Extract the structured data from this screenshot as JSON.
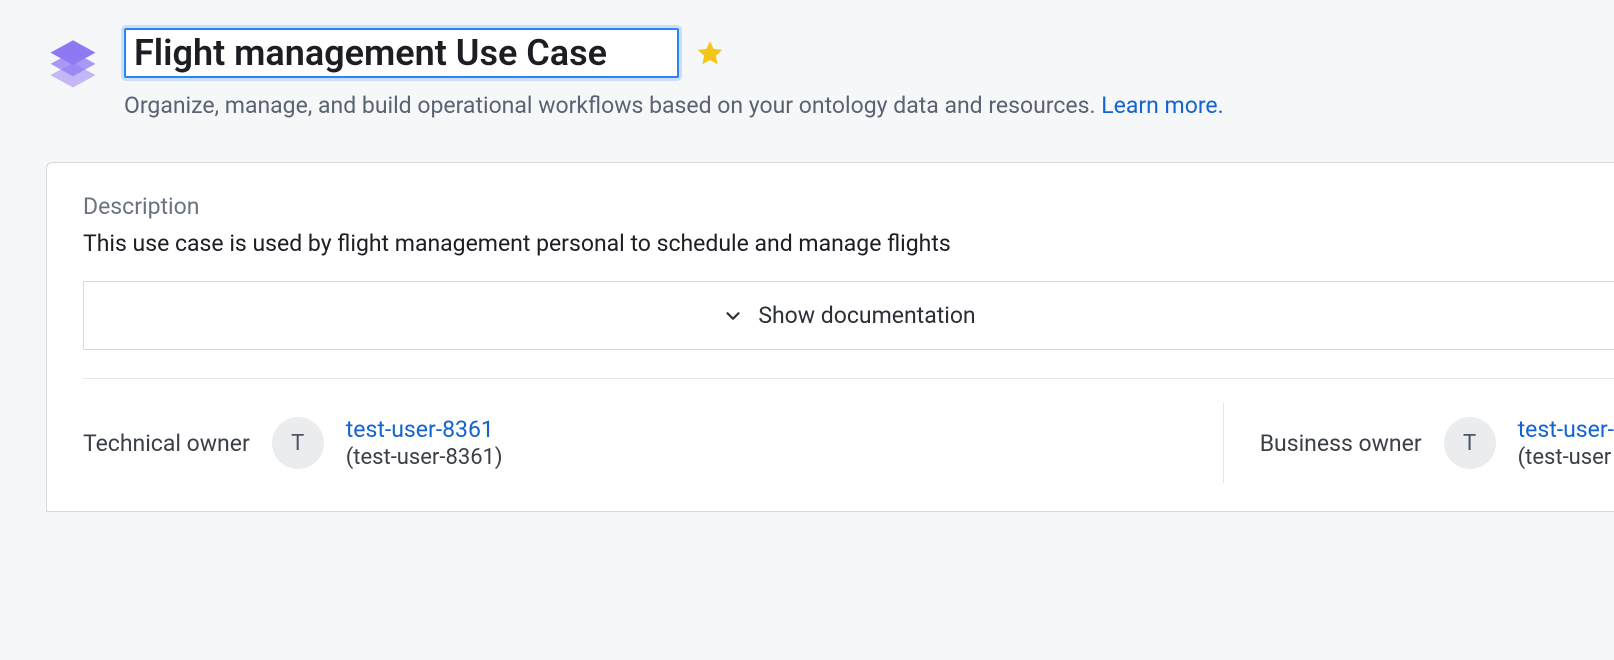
{
  "header": {
    "title": "Flight management Use Case",
    "subtitle": "Organize, manage, and build operational workflows based on your ontology data and resources.",
    "learn_more": "Learn more."
  },
  "card": {
    "description_label": "Description",
    "description_text": "This use case is used by flight management personal to schedule and manage flights",
    "show_docs_label": "Show documentation"
  },
  "owners": {
    "technical_label": "Technical owner",
    "technical_avatar": "T",
    "technical_user": "test-user-8361",
    "technical_sub": "(test-user-8361)",
    "business_label": "Business owner",
    "business_avatar": "T",
    "business_user": "test-user-",
    "business_sub": "(test-user"
  }
}
